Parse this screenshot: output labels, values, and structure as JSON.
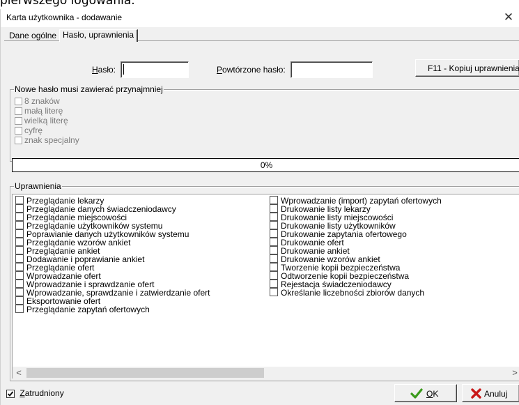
{
  "top_caption": "pierwszego logowania.",
  "window": {
    "title": "Karta użytkownika - dodawanie",
    "close_glyph": "✕"
  },
  "tabs": [
    "Dane ogólne",
    "Hasło, uprawnienia"
  ],
  "password": {
    "label_accel": "H",
    "label_rest": "asło:",
    "value": "",
    "repeat_label_accel": "P",
    "repeat_label_rest": "owtórzone hasło:",
    "repeat_value": "",
    "copy_button": "F11 - Kopiuj uprawnienia"
  },
  "requirements": {
    "legend": "Nowe hasło musi zawierać przynajmniej",
    "items": [
      "8 znaków",
      "małą literę",
      "wielką literę",
      "cyfrę",
      "znak specjalny"
    ],
    "strength_progress": "0%"
  },
  "permissions": {
    "legend": "Uprawnienia",
    "left": [
      "Przeglądanie lekarzy",
      "Przeglądanie danych świadczeniodawcy",
      "Przeglądanie miejscowości",
      "Przeglądanie użytkowników systemu",
      "Poprawianie danych użytkowników systemu",
      "Przeglądanie wzorów ankiet",
      "Przeglądanie ankiet",
      "Dodawanie i poprawianie ankiet",
      "Przeglądanie ofert",
      "Wprowadzanie ofert",
      "Wprowadzanie i sprawdzanie ofert",
      "Wprowadzanie, sprawdzanie i zatwierdzanie ofert",
      "Eksportowanie ofert",
      "Przeglądanie zapytań ofertowych"
    ],
    "right": [
      "Wprowadzanie (import) zapytań ofertowych",
      "Drukowanie listy lekarzy",
      "Drukowanie listy miejscowości",
      "Drukowanie listy użytkowników",
      "Drukowanie zapytania ofertowego",
      "Drukowanie ofert",
      "Drukowanie ankiet",
      "Drukowanie wzorów ankiet",
      "Tworzenie kopii bezpieczeństwa",
      "Odtworzenie kopii bezpieczeństwa",
      "Rejestacja świadczeniodawcy",
      "Określanie liczebności zbiorów danych"
    ],
    "scroll_left": "<",
    "scroll_right": ">"
  },
  "footer": {
    "employed_checked": true,
    "employed_accel": "Z",
    "employed_rest": "atrudniony",
    "ok_accel": "O",
    "ok_rest": "K",
    "cancel_label": "Anuluj",
    "colors": {
      "ok_check": "#3a9a1a",
      "cancel_x": "#c81818"
    }
  }
}
